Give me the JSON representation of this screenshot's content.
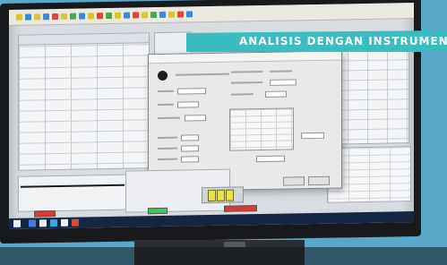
{
  "overlay": {
    "banner_text": "ANALISIS DENGAN INSTRUMEN",
    "banner_color": "#3bbcbf"
  },
  "photo": {
    "monitor_brand_logo": "dell-logo",
    "taskbar_icons": [
      "windows-start-icon",
      "taskbar-app-icon"
    ],
    "indicator_colors": [
      "#d93c35",
      "#3fc65a",
      "#d93c35"
    ]
  }
}
